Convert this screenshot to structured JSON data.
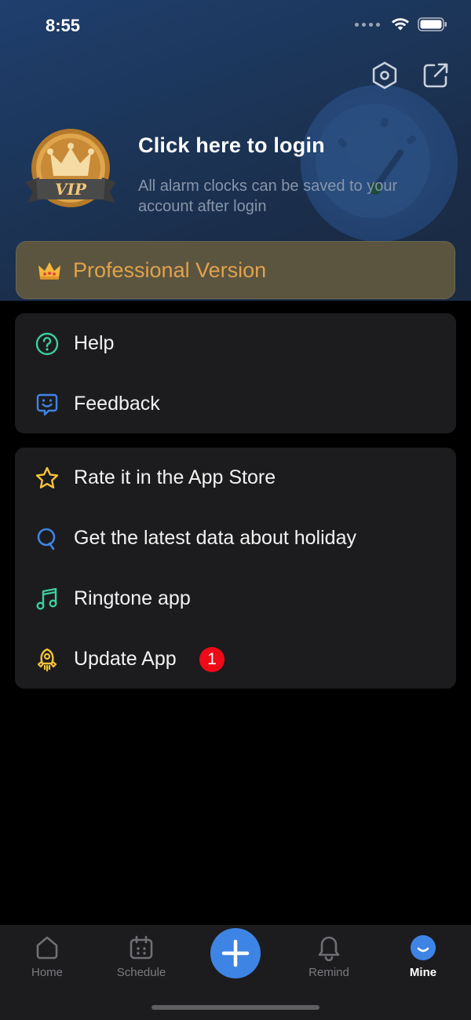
{
  "status_bar": {
    "time": "8:55"
  },
  "header": {
    "login_title": "Click here to login",
    "login_subtitle": "All alarm clocks can be saved to your account after login",
    "vip_text": "VIP"
  },
  "pro_banner": {
    "label": "Professional Version"
  },
  "card1": {
    "items": [
      {
        "label": "Help",
        "icon": "help-icon"
      },
      {
        "label": "Feedback",
        "icon": "feedback-icon"
      }
    ]
  },
  "card2": {
    "items": [
      {
        "label": "Rate it in the App Store",
        "icon": "star-icon"
      },
      {
        "label": "Get the latest data about holiday",
        "icon": "holiday-icon"
      },
      {
        "label": "Ringtone app",
        "icon": "music-icon"
      },
      {
        "label": "Update App",
        "icon": "rocket-icon",
        "badge": "1"
      }
    ]
  },
  "tabbar": {
    "home": "Home",
    "schedule": "Schedule",
    "remind": "Remind",
    "mine": "Mine",
    "active": "Mine"
  },
  "colors": {
    "accent": "#3e84e4",
    "gold": "#e1a24a",
    "badge": "#ee0a17",
    "teal": "#3ccf9b"
  }
}
